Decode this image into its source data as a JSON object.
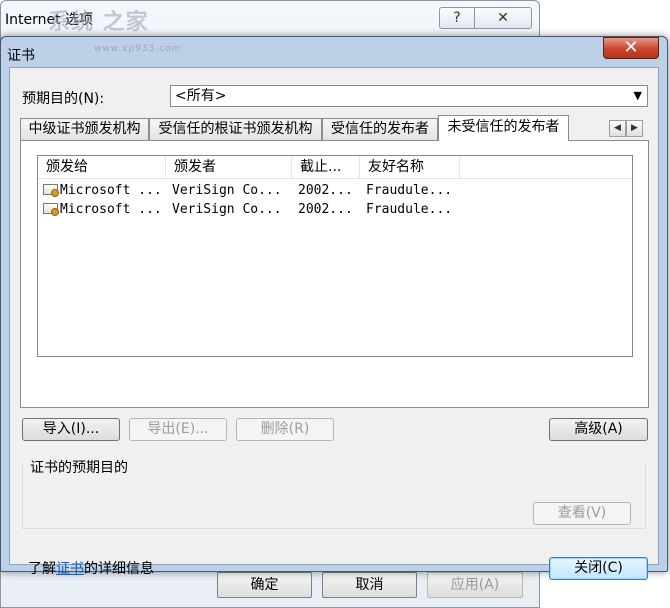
{
  "back_window": {
    "title": "Internet 选项",
    "help_glyph": "?",
    "close_glyph": "✕",
    "buttons": {
      "ok": "确定",
      "cancel": "取消",
      "apply": "应用(A)"
    }
  },
  "dialog": {
    "title": "证书",
    "close_glyph": "✕",
    "purpose": {
      "label": "预期目的(N):",
      "value": "<所有>",
      "arrow": "▼"
    },
    "tabs": [
      {
        "label": "中级证书颁发机构",
        "selected": false
      },
      {
        "label": "受信任的根证书颁发机构",
        "selected": false
      },
      {
        "label": "受信任的发布者",
        "selected": false
      },
      {
        "label": "未受信任的发布者",
        "selected": true
      }
    ],
    "tab_scroll": {
      "left": "◀",
      "right": "▶"
    },
    "list": {
      "columns": [
        "颁发给",
        "颁发者",
        "截止...",
        "友好名称"
      ],
      "rows": [
        {
          "issued_to": "Microsoft ...",
          "issued_by": "VeriSign Co...",
          "expires": "2002...",
          "friendly_name": "Fraudule..."
        },
        {
          "issued_to": "Microsoft ...",
          "issued_by": "VeriSign Co...",
          "expires": "2002...",
          "friendly_name": "Fraudule..."
        }
      ]
    },
    "buttons": {
      "import": "导入(I)...",
      "export": "导出(E)...",
      "delete": "删除(R)",
      "advanced": "高级(A)",
      "view": "查看(V)",
      "close": "关闭(C)"
    },
    "purposes_label": "证书的预期目的",
    "learn_more": {
      "prefix": "了解",
      "link": "证书",
      "suffix": "的详细信息"
    }
  },
  "watermark": {
    "text": "系统 之家",
    "sub": "www.xp933.com"
  }
}
